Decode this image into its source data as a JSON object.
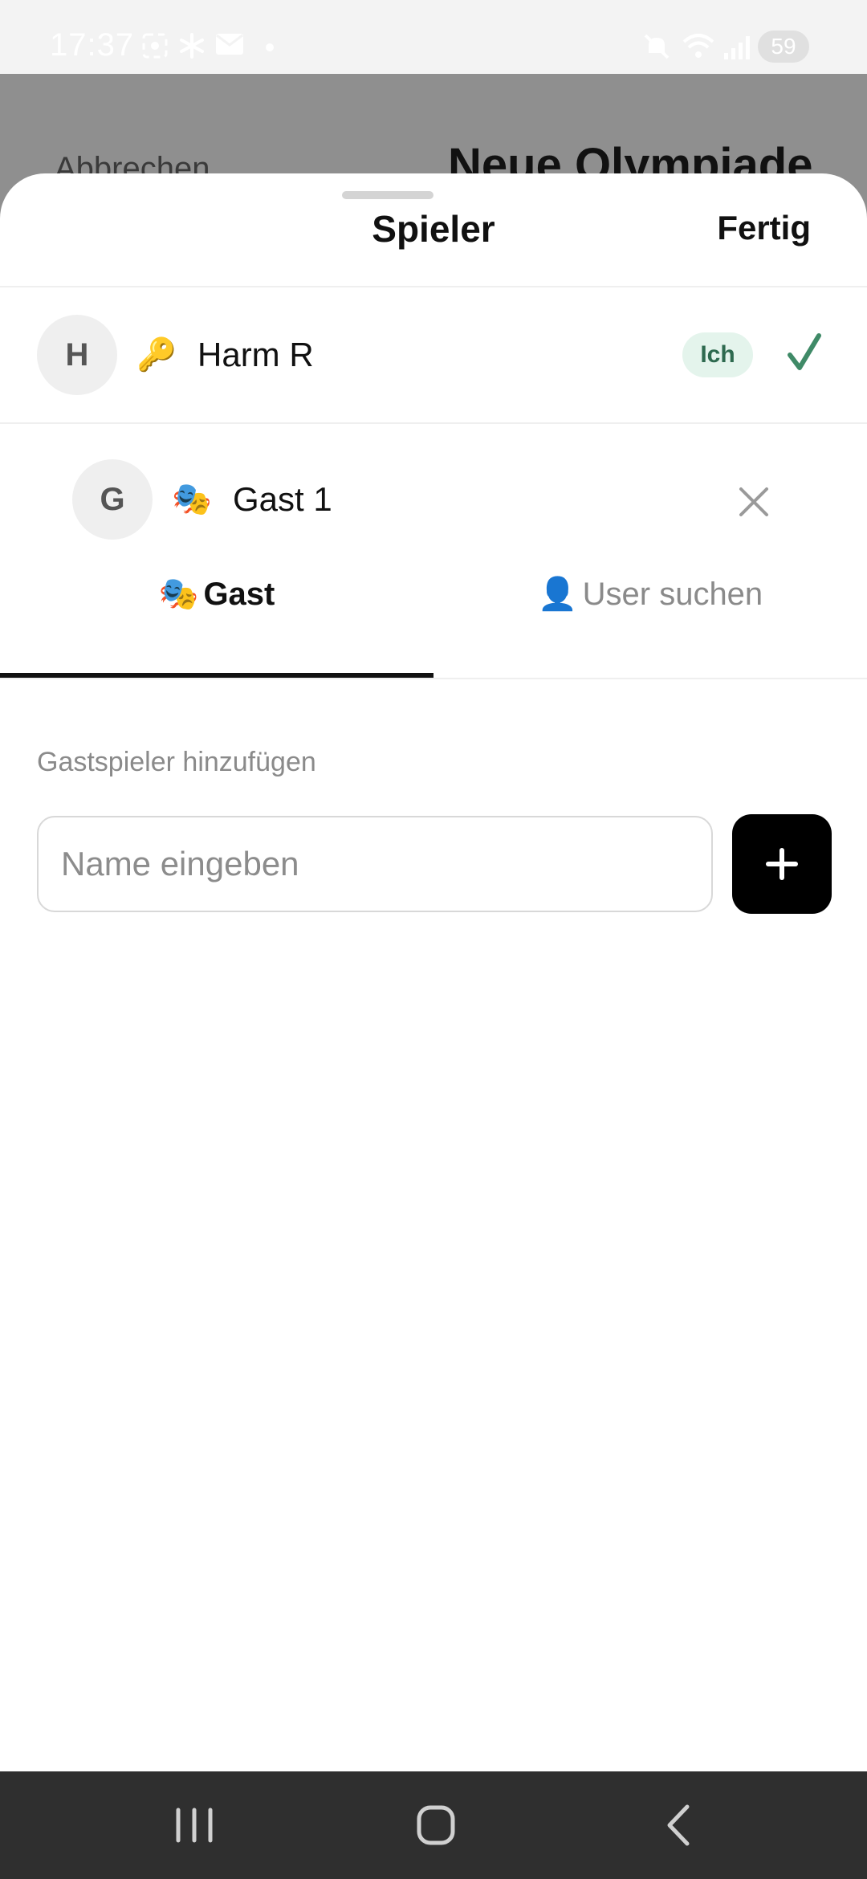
{
  "status_bar": {
    "time": "17:37",
    "battery": "59",
    "icons": [
      "screenshot-icon",
      "fan-icon",
      "mail-icon",
      "dot-icon",
      "mute-icon",
      "wifi-icon",
      "signal-icon"
    ]
  },
  "background_page": {
    "cancel_label": "Abbrechen",
    "title": "Neue Olympiade"
  },
  "sheet": {
    "title": "Spieler",
    "done_label": "Fertig",
    "players": [
      {
        "initial": "H",
        "emoji": "🔑",
        "name": "Harm R",
        "badge": "Ich",
        "selected": true
      },
      {
        "initial": "G",
        "emoji": "🎭",
        "name": "Gast 1",
        "removable": true
      }
    ],
    "tabs": [
      {
        "emoji": "🎭",
        "label": "Gast",
        "active": true
      },
      {
        "emoji": "👤",
        "label": "User suchen",
        "active": false
      }
    ],
    "add_guest": {
      "label": "Gastspieler hinzufügen",
      "input_value": "",
      "input_placeholder": "Name eingeben",
      "button_icon": "plus-icon"
    }
  },
  "nav_bar": {
    "buttons": [
      "recent-apps-icon",
      "home-icon",
      "back-icon"
    ]
  },
  "colors": {
    "accent_check": "#3f8a67",
    "badge_bg": "#e4f4ec",
    "badge_text": "#2e6a4f",
    "overlay": "#8f8f8f",
    "nav_bar": "#2f2f2f"
  }
}
